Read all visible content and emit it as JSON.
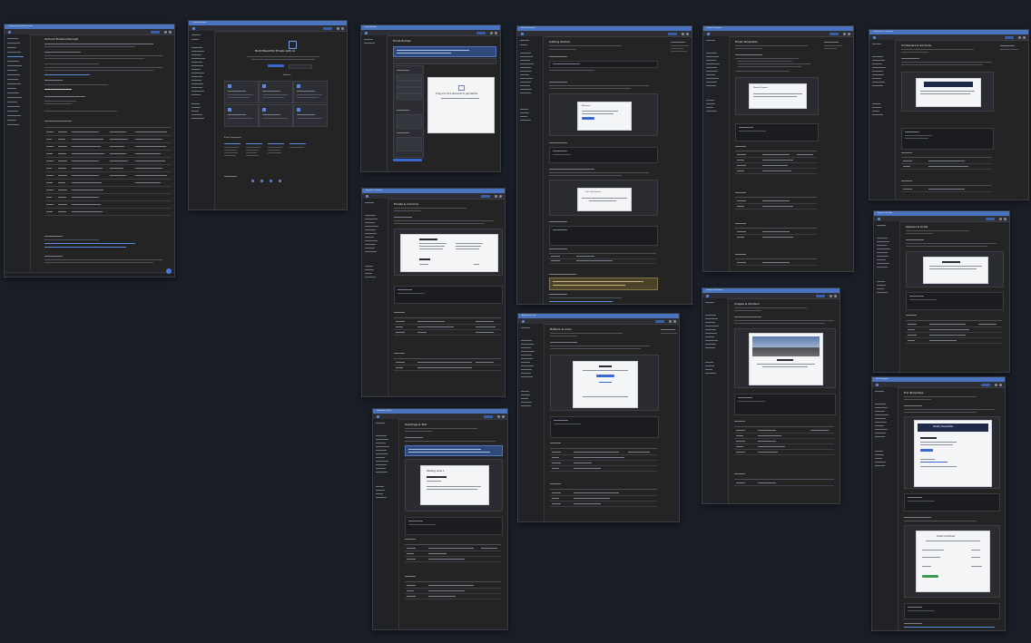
{
  "windows": [
    {
      "id": "w1",
      "title": "Customizing Outlook views",
      "page_title": "Outlook Emails Intercept",
      "left_heading": "Outlook Emails"
    },
    {
      "id": "w2",
      "title": "Outlook Builder",
      "page_title": "Build Beautiful Emails with AI",
      "section_title": "Features",
      "section2_title": "Email Components"
    },
    {
      "id": "w3",
      "title": "Email Builder",
      "page_title": "Email Builder",
      "preview_title": "Drag and drop elements to get started"
    },
    {
      "id": "w4",
      "title": "Getting Started",
      "page_title": "Getting Started",
      "welcome_title": "Welcome!",
      "footer_title": "Let's Get Started"
    },
    {
      "id": "w5",
      "title": "Email Templates",
      "page_title": "Email Templates",
      "card_title": "Monthly Update"
    },
    {
      "id": "w6",
      "title": "Containers & Sections",
      "page_title": "Containers & Sections"
    },
    {
      "id": "w7",
      "title": "Emails & Columns",
      "page_title": "Emails & Columns"
    },
    {
      "id": "w8",
      "title": "Buttons & Links",
      "page_title": "Buttons & Links"
    },
    {
      "id": "w9",
      "title": "Images & Dividers",
      "page_title": "Images & Dividers"
    },
    {
      "id": "w10",
      "title": "Spacers & Grids",
      "page_title": "Spacers & Grids"
    },
    {
      "id": "w11",
      "title": "Headings & Text",
      "page_title": "Headings & Text",
      "card_title": "Heading Level 1"
    },
    {
      "id": "w12",
      "title": "Full Templates",
      "page_title": "Full Templates",
      "card_title": "Weekly Newsletter",
      "order_title": "Order Confirmed"
    }
  ],
  "colors": {
    "background": "#1a1e27",
    "titlebar": "#4a74c0",
    "window": "#242424",
    "accent": "#5a8be0"
  }
}
